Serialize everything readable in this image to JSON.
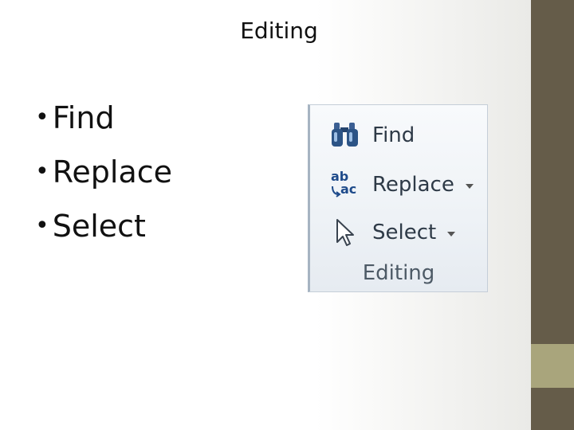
{
  "slide": {
    "title": "Editing",
    "bullets": [
      {
        "bullet": "•",
        "text": "Find"
      },
      {
        "bullet": "•",
        "text": "Replace"
      },
      {
        "bullet": "•",
        "text": "Select"
      }
    ]
  },
  "ribbon": {
    "items": [
      {
        "label": "Find",
        "icon": "binoculars-icon"
      },
      {
        "label": "Replace",
        "icon": "replace-ab-ac-icon"
      },
      {
        "label": "Select",
        "icon": "cursor-select-icon"
      }
    ],
    "group_label": "Editing"
  },
  "colors": {
    "band": "#655c49",
    "band_accent": "#a9a57c",
    "ribbon_text": "#2e3a47"
  }
}
